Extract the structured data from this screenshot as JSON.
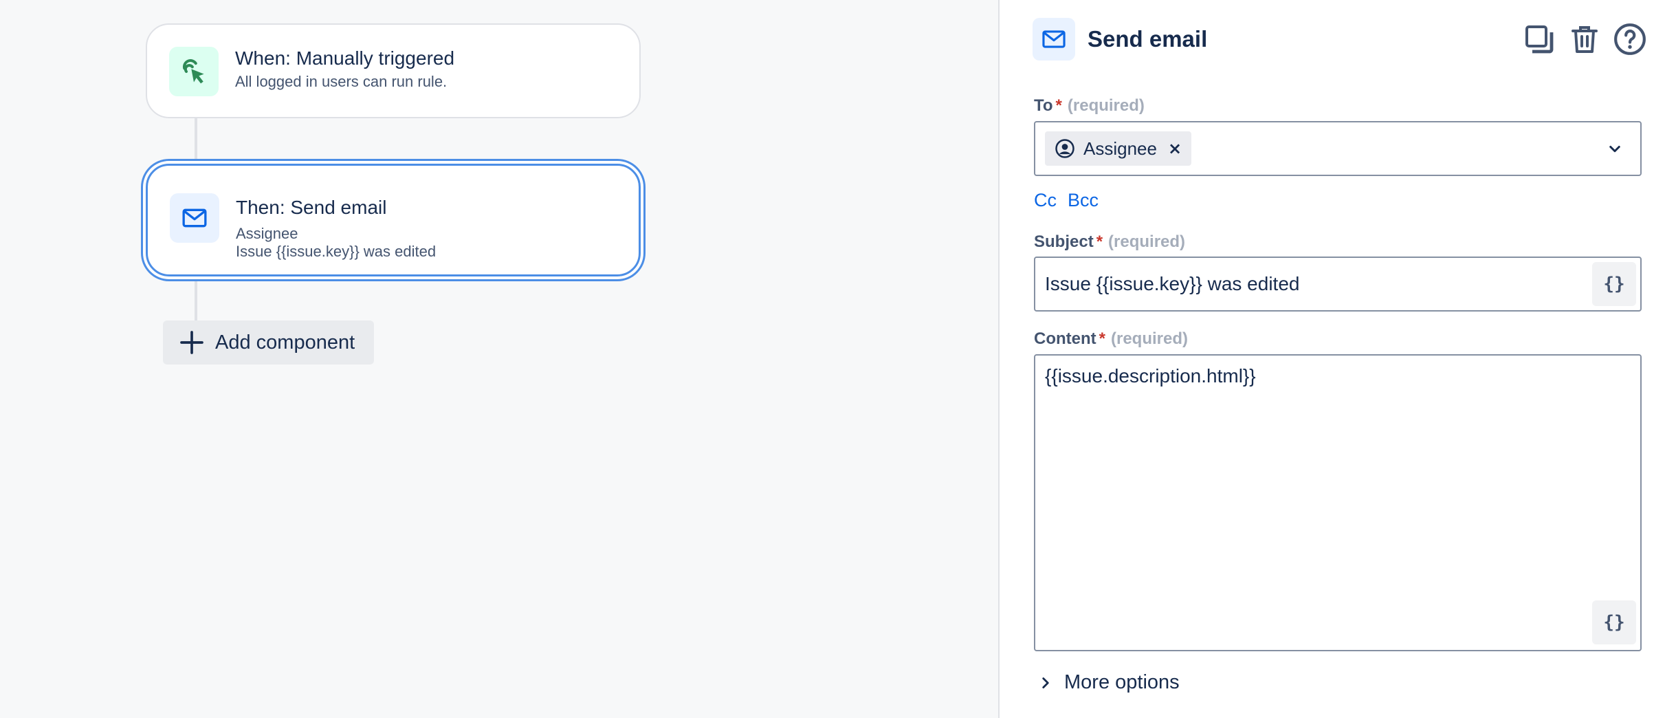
{
  "canvas": {
    "trigger": {
      "title": "When: Manually triggered",
      "subtitle": "All logged in users can run rule.",
      "icon": "cursor-click-icon"
    },
    "action": {
      "title": "Then: Send email",
      "line1": "Assignee",
      "line2": "Issue {{issue.key}} was edited",
      "icon": "mail-icon"
    },
    "add_component_label": "Add component"
  },
  "panel": {
    "title": "Send email",
    "header_icons": [
      "duplicate-icon",
      "trash-icon",
      "help-icon"
    ],
    "to": {
      "label": "To",
      "required_star": "*",
      "required_text": "(required)",
      "chip": "Assignee",
      "chip_remove": "×"
    },
    "cc_label": "Cc",
    "bcc_label": "Bcc",
    "subject": {
      "label": "Subject",
      "required_star": "*",
      "required_text": "(required)",
      "value": "Issue {{issue.key}} was edited",
      "smart_value_label": "{}"
    },
    "content": {
      "label": "Content",
      "required_star": "*",
      "required_text": "(required)",
      "value": "{{issue.description.html}}",
      "smart_value_label": "{}"
    },
    "more_options_label": "More options"
  },
  "colors": {
    "accent": "#0c66e4",
    "selected_border": "#4c8ee6",
    "required": "#c9372c",
    "trigger_icon_bg": "#dcfff1",
    "action_icon_bg": "#e9f2ff"
  }
}
